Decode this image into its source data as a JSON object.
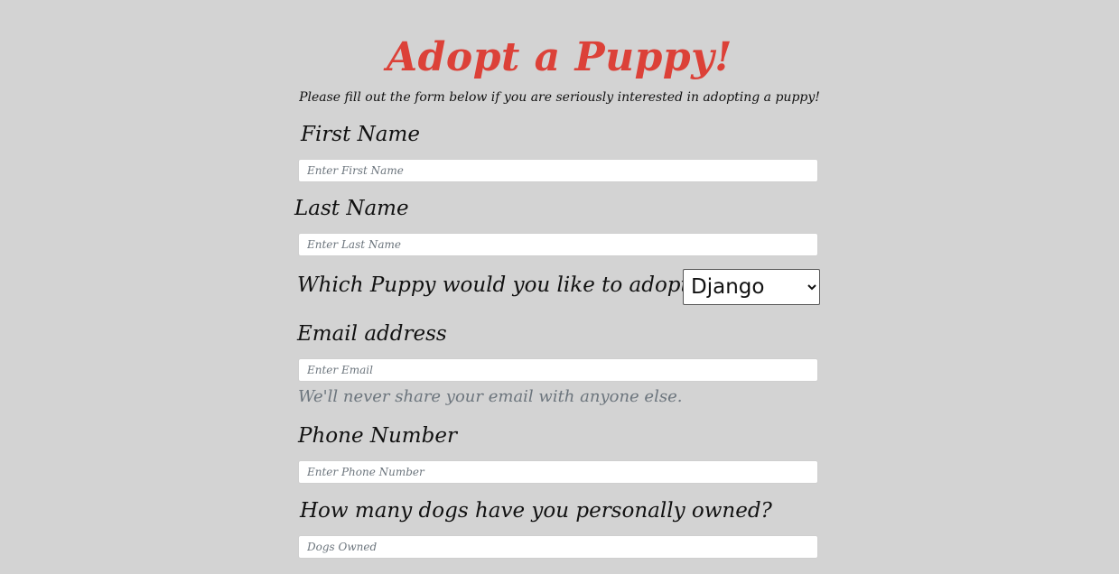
{
  "header": {
    "title": "Adopt a Puppy!",
    "subtitle": "Please fill out the form below if you are seriously interested in adopting a puppy!"
  },
  "form": {
    "first_name": {
      "label": "First Name",
      "placeholder": "Enter First Name",
      "value": ""
    },
    "last_name": {
      "label": "Last Name",
      "placeholder": "Enter Last Name",
      "value": ""
    },
    "puppy": {
      "label": "Which Puppy would you like to adopt?",
      "selected": "Django",
      "options": [
        "Django"
      ]
    },
    "email": {
      "label": "Email address",
      "placeholder": "Enter Email",
      "value": "",
      "help": "We'll never share your email with anyone else."
    },
    "phone": {
      "label": "Phone Number",
      "placeholder": "Enter Phone Number",
      "value": ""
    },
    "dogs_owned": {
      "label": "How many dogs have you personally owned?",
      "placeholder": "Dogs Owned",
      "value": ""
    }
  },
  "colors": {
    "background": "#d3d3d3",
    "title": "#dc4138",
    "help_text": "#6c757d"
  }
}
